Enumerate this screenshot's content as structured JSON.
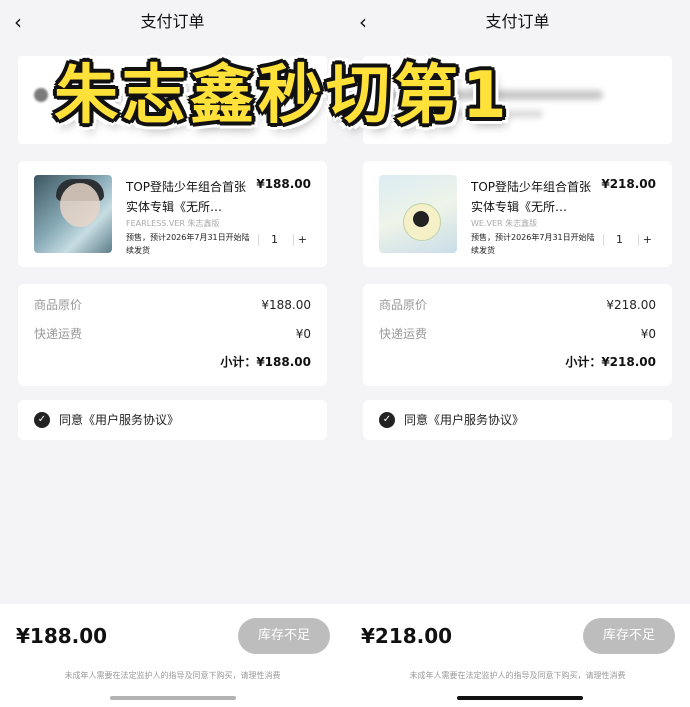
{
  "overlay_caption": "朱志鑫秒切第1",
  "panels": [
    {
      "header": {
        "back_icon": "chevron-left-icon",
        "title": "支付订单"
      },
      "product": {
        "name": "TOP登陆少年组合首张实体专辑《无所…",
        "price": "¥188.00",
        "version": "FEARLESS.VER 朱志鑫版",
        "presale": "预售，预计2026年7月31日开始陆续发货",
        "minus": "-",
        "qty": "1",
        "plus": "+"
      },
      "summary": {
        "original_label": "商品原价",
        "original_value": "¥188.00",
        "shipping_label": "快递运费",
        "shipping_value": "¥0",
        "subtotal": "小计：¥188.00"
      },
      "agreement": {
        "check_icon": "check-circle-icon",
        "text": "同意《用户服务协议》"
      },
      "footer": {
        "total": "¥188.00",
        "button": "库存不足",
        "notice": "未成年人需要在法定监护人的指导及同意下购买，请理性消费"
      }
    },
    {
      "header": {
        "back_icon": "chevron-left-icon",
        "title": "支付订单"
      },
      "product": {
        "name": "TOP登陆少年组合首张实体专辑《无所…",
        "price": "¥218.00",
        "version": "WE.VER 朱志鑫版",
        "presale": "预售，预计2026年7月31日开始陆续发货",
        "minus": "-",
        "qty": "1",
        "plus": "+"
      },
      "summary": {
        "original_label": "商品原价",
        "original_value": "¥218.00",
        "shipping_label": "快递运费",
        "shipping_value": "¥0",
        "subtotal": "小计：¥218.00"
      },
      "agreement": {
        "check_icon": "check-circle-icon",
        "text": "同意《用户服务协议》"
      },
      "footer": {
        "total": "¥218.00",
        "button": "库存不足",
        "notice": "未成年人需要在法定监护人的指导及同意下购买，请理性消费"
      }
    }
  ]
}
